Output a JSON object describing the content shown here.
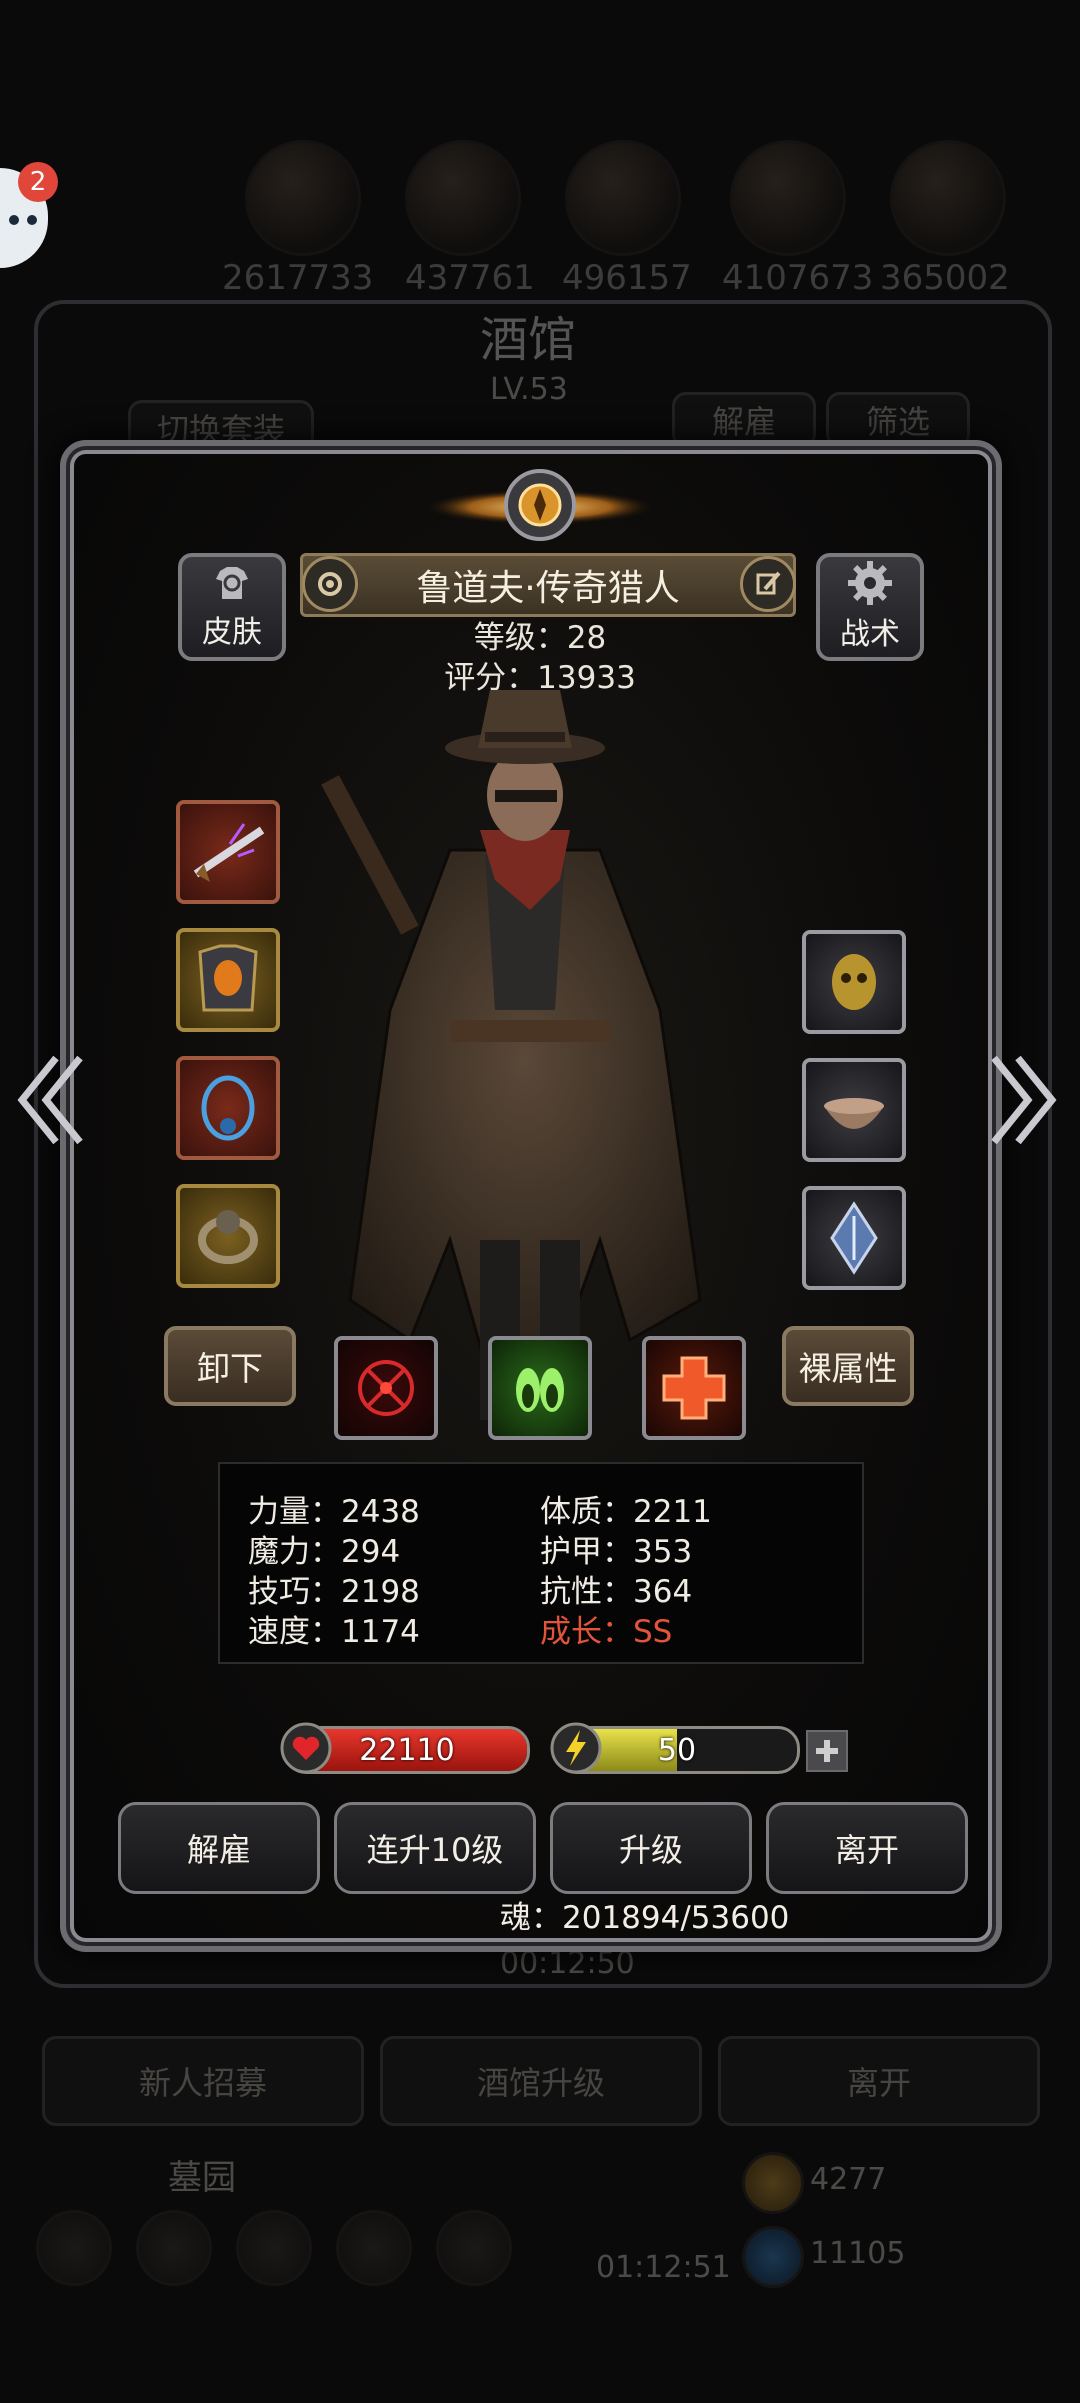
{
  "chat_badge": {
    "count": "2"
  },
  "background": {
    "resources": [
      "2617733",
      "437761",
      "496157",
      "4107673",
      "365002"
    ],
    "title": "酒馆",
    "level": "LV.53",
    "switch_outfit": "切换套装",
    "dismiss": "解雇",
    "filter": "筛选",
    "timer": "00:12:50",
    "recruit": "新人招募",
    "upgrade_tavern": "酒馆升级",
    "leave": "离开",
    "cemetery": "墓园",
    "bottom_timer": "01:12:51",
    "gold": "4277",
    "gems": "11105"
  },
  "hero": {
    "skin_label": "皮肤",
    "tactics_label": "战术",
    "name": "鲁道夫·传奇猎人",
    "level_text": "等级：28",
    "score_text": "评分：13933",
    "unequip_label": "卸下",
    "base_attr_label": "裸属性"
  },
  "stats": {
    "strength": "力量：2438",
    "constitution": "体质：2211",
    "magic": "魔力：294",
    "armor": "护甲：353",
    "skill": "技巧：2198",
    "resistance": "抗性：364",
    "speed": "速度：1174",
    "growth": "成长：SS"
  },
  "bars": {
    "hp": "22110",
    "energy": "50",
    "hp_fill": 1.0,
    "energy_fill": 0.5
  },
  "actions": {
    "dismiss": "解雇",
    "level_up_10": "连升10级",
    "level_up": "升级",
    "leave": "离开"
  },
  "soul_text": "魂：201894/53600",
  "colors": {
    "hp_red": "#d0241e",
    "energy_yellow": "#d9d23a",
    "growth_red": "#e2553a"
  }
}
